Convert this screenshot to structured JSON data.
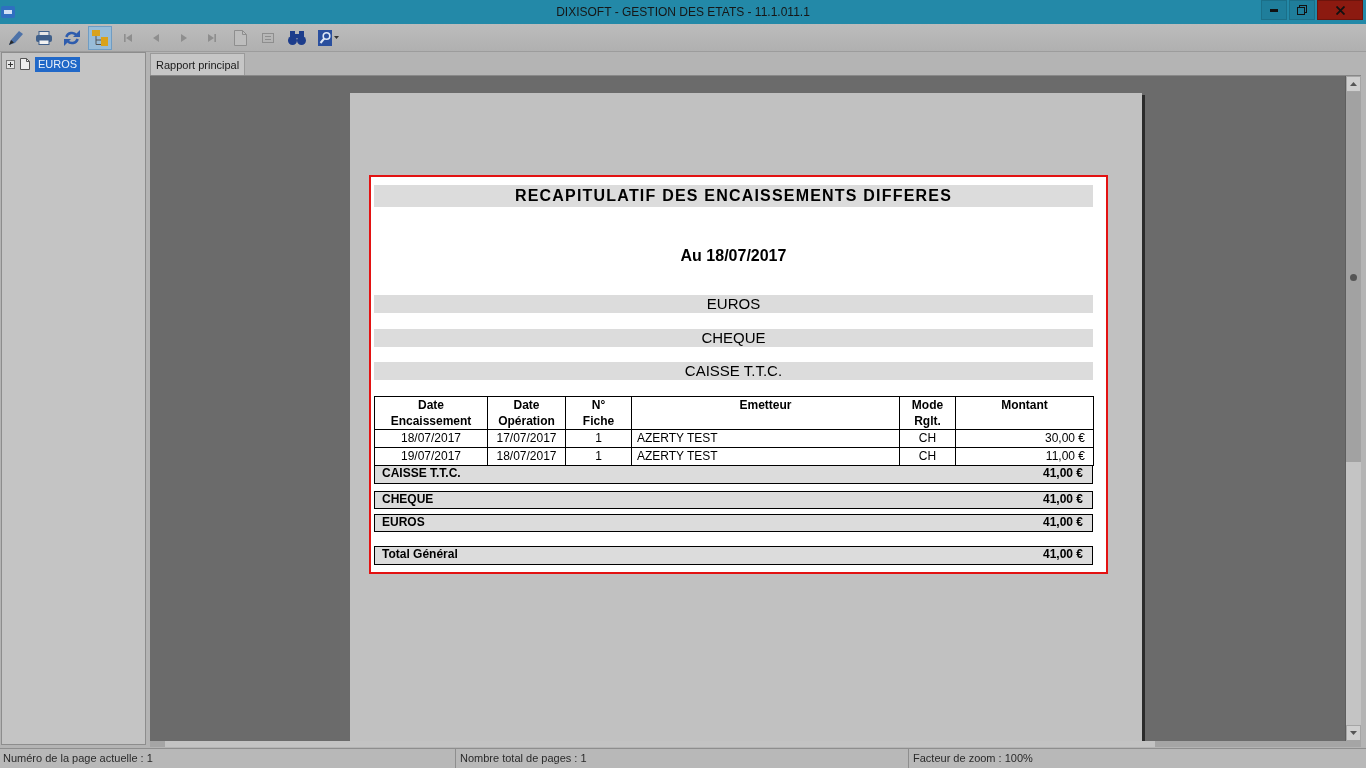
{
  "window": {
    "title": "DIXISOFT - GESTION DES ETATS - 11.1.011.1"
  },
  "toolbar": [
    {
      "kind": "export",
      "pressed": false,
      "disabled": false
    },
    {
      "kind": "print",
      "pressed": false,
      "disabled": false
    },
    {
      "kind": "refresh",
      "pressed": false,
      "disabled": false
    },
    {
      "kind": "tree",
      "pressed": true,
      "disabled": false
    },
    {
      "kind": "first",
      "pressed": false,
      "disabled": true
    },
    {
      "kind": "previous",
      "pressed": false,
      "disabled": true
    },
    {
      "kind": "next",
      "pressed": false,
      "disabled": true
    },
    {
      "kind": "last",
      "pressed": false,
      "disabled": true
    },
    {
      "kind": "page",
      "pressed": false,
      "disabled": true
    },
    {
      "kind": "lines",
      "pressed": false,
      "disabled": true
    },
    {
      "kind": "search",
      "pressed": false,
      "disabled": false
    },
    {
      "kind": "zoom",
      "pressed": false,
      "disabled": false
    }
  ],
  "sidebar": {
    "tree": [
      {
        "label": "EUROS",
        "selected": true,
        "expanded": false
      }
    ]
  },
  "tabs": [
    {
      "label": "Rapport principal",
      "selected": true
    }
  ],
  "report": {
    "title": "RECAPITULATIF DES ENCAISSEMENTS DIFFERES",
    "date": "Au 18/07/2017",
    "groups": [
      "EUROS",
      "CHEQUE",
      "CAISSE T.T.C."
    ],
    "table": {
      "columns": [
        "Date\nEncaissement",
        "Date\nOpération",
        "N°\nFiche",
        "Emetteur",
        "Mode\nRglt.",
        "Montant"
      ],
      "rows": [
        [
          "18/07/2017",
          "17/07/2017",
          "1",
          "AZERTY TEST",
          "CH",
          "30,00 €"
        ],
        [
          "19/07/2017",
          "18/07/2017",
          "1",
          "AZERTY TEST",
          "CH",
          "11,00 €"
        ]
      ]
    },
    "subtotals": [
      {
        "label": "CAISSE T.T.C.",
        "amount": "41,00 €"
      },
      {
        "label": "CHEQUE",
        "amount": "41,00 €"
      },
      {
        "label": "EUROS",
        "amount": "41,00 €"
      }
    ],
    "grand_total": {
      "label": "Total Général",
      "amount": "41,00 €"
    }
  },
  "status_bar": [
    "Numéro de la page actuelle : 1",
    "Nombre total de pages : 1",
    "Facteur de zoom : 100%"
  ]
}
